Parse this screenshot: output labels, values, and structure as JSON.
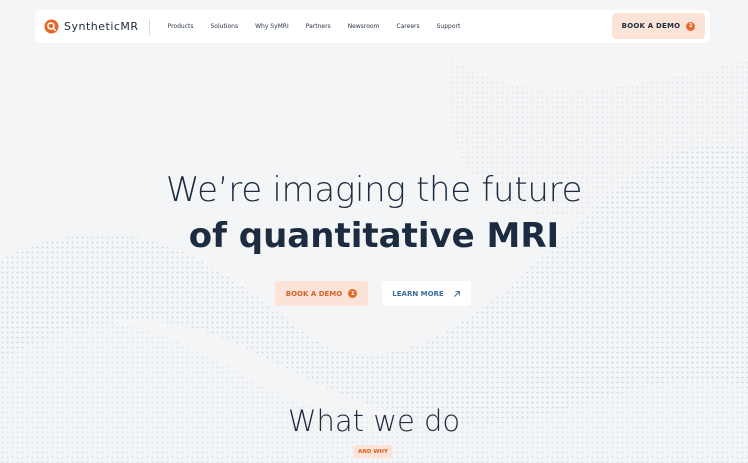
{
  "brand": {
    "name": "SyntheticMR",
    "icon": "synthetic-mr-logo-icon",
    "accent": "#e36a2c"
  },
  "nav": {
    "items": [
      {
        "label": "Products"
      },
      {
        "label": "Solutions"
      },
      {
        "label": "Why SyMRI"
      },
      {
        "label": "Partners"
      },
      {
        "label": "Newsroom"
      },
      {
        "label": "Careers"
      },
      {
        "label": "Support"
      }
    ],
    "cta_label": "BOOK A DEMO",
    "cta_badge": "1"
  },
  "hero": {
    "line1": "We’re imaging the future",
    "line2": "of quantitative MRI",
    "primary_button": {
      "label": "BOOK A DEMO",
      "badge": "1"
    },
    "secondary_button": {
      "label": "LEARN MORE",
      "icon": "arrow-up-right-icon"
    }
  },
  "section": {
    "title": "What we do",
    "tag": "AND WHY"
  },
  "colors": {
    "background": "#f4f5f6",
    "text": "#1c2b3f",
    "accent": "#e36a2c",
    "accent_soft": "#fbe4d7",
    "link": "#3a6e9c"
  }
}
